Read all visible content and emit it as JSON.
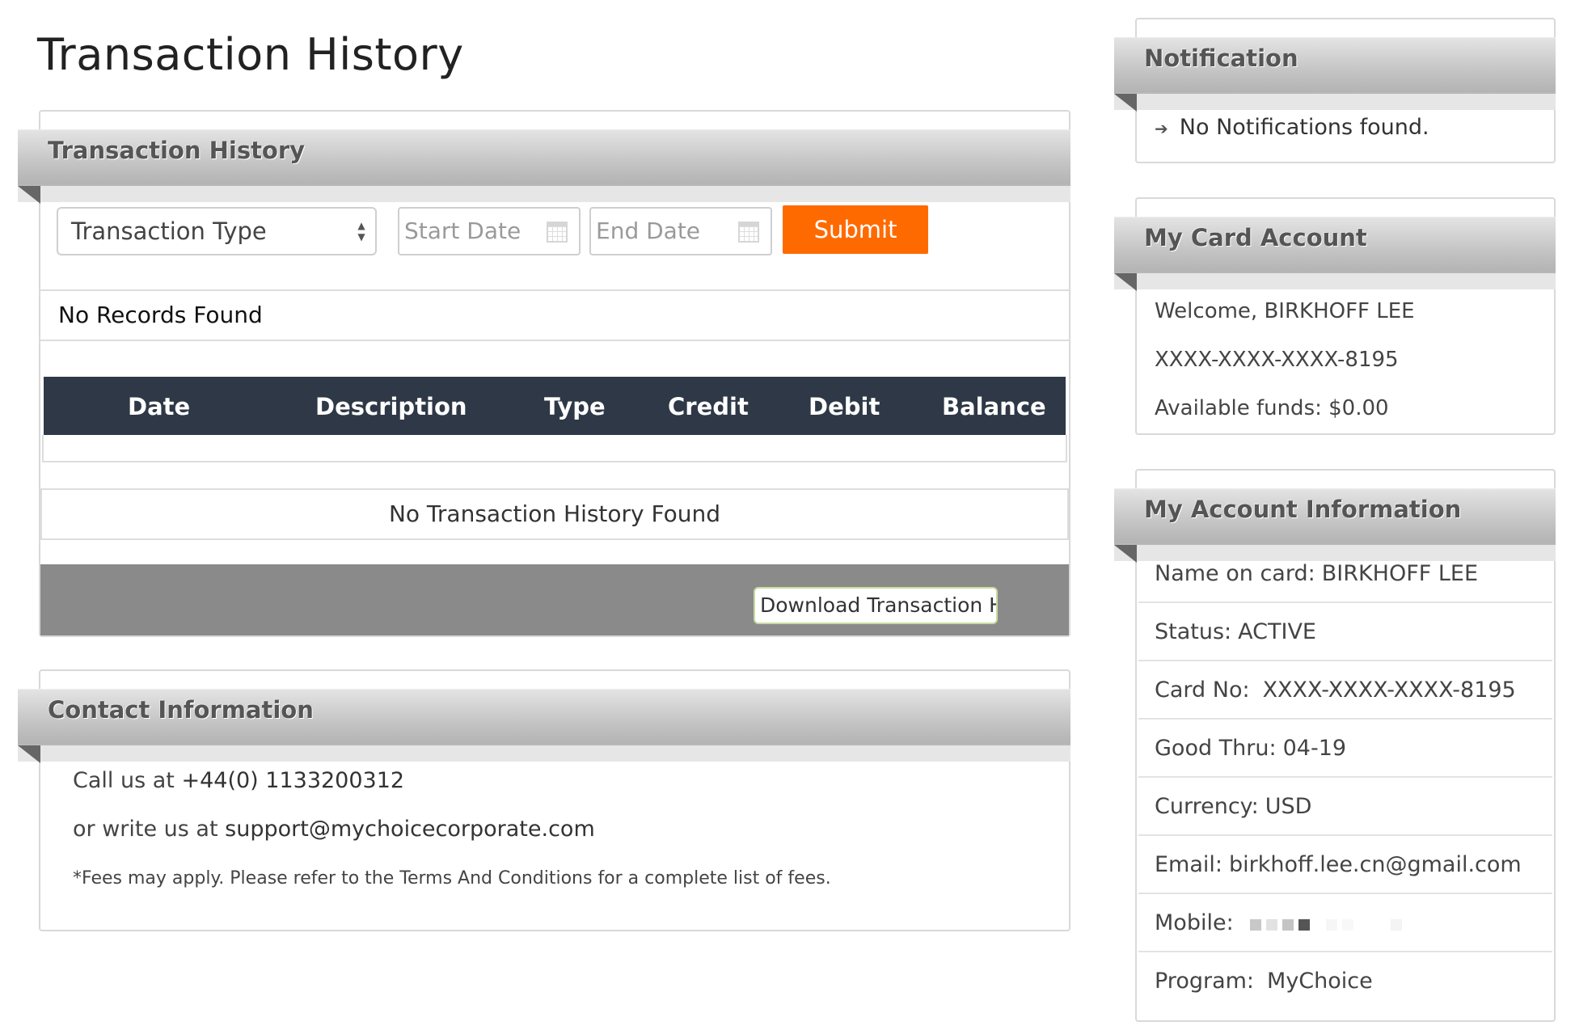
{
  "page_title": "Transaction History",
  "transaction_panel": {
    "title": "Transaction History",
    "transaction_type_select": "Transaction Type",
    "start_date_placeholder": "Start Date",
    "end_date_placeholder": "End Date",
    "submit_label": "Submit",
    "no_records": "No Records Found",
    "columns": [
      "Date",
      "Description",
      "Type",
      "Credit",
      "Debit",
      "Balance"
    ],
    "no_history": "No Transaction History Found",
    "download_label": "Download Transaction History"
  },
  "contact_panel": {
    "title": "Contact Information",
    "call_prefix": "Call us at",
    "phone": "+44(0) 1133200312",
    "write_prefix": "or write us at",
    "email": "support@mychoicecorporate.com",
    "fees_note": "*Fees may apply. Please refer to the Terms And Conditions for a complete list of fees."
  },
  "notification_panel": {
    "title": "Notification",
    "message": "No Notifications found."
  },
  "card_panel": {
    "title": "My Card Account",
    "welcome": "Welcome, BIRKHOFF LEE",
    "card_number": "XXXX-XXXX-XXXX-8195",
    "available_funds": "Available funds: $0.00"
  },
  "account_panel": {
    "title": "My Account Information",
    "rows": [
      {
        "label": "Name on card:",
        "value": "BIRKHOFF LEE"
      },
      {
        "label": "Status:",
        "value": "ACTIVE"
      },
      {
        "label": "Card No:",
        "value": "XXXX-XXXX-XXXX-8195"
      },
      {
        "label": "Good Thru:",
        "value": "04-19"
      },
      {
        "label": "Currency:",
        "value": "USD"
      },
      {
        "label": "Email:",
        "value": "birkhoff.lee.cn@gmail.com"
      },
      {
        "label": "Mobile:",
        "value": ""
      },
      {
        "label": "Program:",
        "value": "MyChoice"
      }
    ]
  },
  "colors": {
    "submit": "#ff6a00",
    "table_header": "#2e3846",
    "footer_bar": "#8a8a8a"
  }
}
